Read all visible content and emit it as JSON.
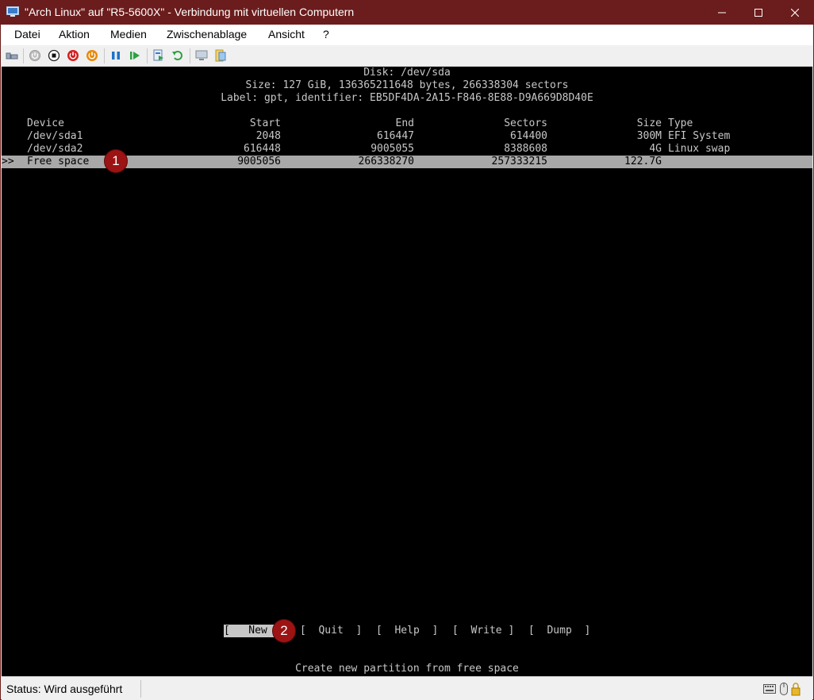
{
  "window": {
    "title": "\"Arch Linux\" auf \"R5-5600X\" - Verbindung mit virtuellen Computern",
    "minimize_icon": "minimize-icon",
    "maximize_icon": "maximize-icon",
    "close_icon": "close-icon"
  },
  "menu": [
    "Datei",
    "Aktion",
    "Medien",
    "Zwischenablage",
    "Ansicht",
    "?"
  ],
  "toolbar_icons": [
    "ctrl-alt-del-icon",
    "start-icon",
    "stop-icon",
    "shutdown-icon",
    "save-icon",
    "pause-icon",
    "resume-icon",
    "checkpoint-icon",
    "revert-icon",
    "enhanced-session-icon",
    "share-icon"
  ],
  "terminal": {
    "disk": "Disk: /dev/sda",
    "size": "Size: 127 GiB, 136365211648 bytes, 266338304 sectors",
    "label": "Label: gpt, identifier: EB5DF4DA-2A15-F846-8E88-D9A669D8D40E",
    "headers": {
      "device": "Device",
      "start": "Start",
      "end": "End",
      "sectors": "Sectors",
      "size": "Size",
      "type": "Type"
    },
    "rows": [
      {
        "device": "/dev/sda1",
        "start": "2048",
        "end": "616447",
        "sectors": "614400",
        "size": "300M",
        "type": "EFI System"
      },
      {
        "device": "/dev/sda2",
        "start": "616448",
        "end": "9005055",
        "sectors": "8388608",
        "size": "4G",
        "type": "Linux swap"
      }
    ],
    "selected": {
      "marker": ">>",
      "device": "Free space",
      "start": "9005056",
      "end": "266338270",
      "sectors": "257333215",
      "size": "122.7G"
    },
    "buttons": {
      "new": "[   New  ]",
      "quit": "[  Quit  ]",
      "help": "[  Help  ]",
      "write": "[  Write ]",
      "dump": "[  Dump  ]"
    },
    "hint": "Create new partition from free space"
  },
  "badges": [
    "1",
    "2"
  ],
  "status": {
    "text": "Status: Wird ausgeführt"
  },
  "colors": {
    "titlebar": "#6b1c1c",
    "badge": "#9c1313",
    "selection": "#a8a8a8"
  }
}
